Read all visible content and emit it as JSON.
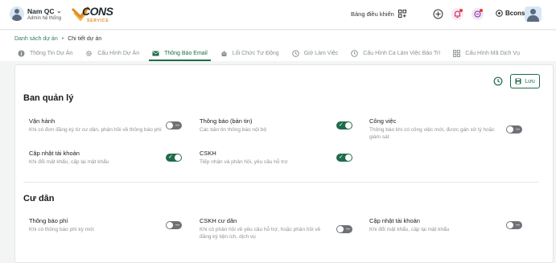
{
  "topbar": {
    "user_name": "Nam QC",
    "user_role": "Admin hệ thống",
    "logo_text": "CONS",
    "logo_sub": "SERVICE",
    "dashboard_label": "Bảng điều khiển",
    "org_name": "Bcons"
  },
  "breadcrumb": {
    "parent": "Danh sách dự án",
    "current": "Chi tiết dự án"
  },
  "tabs": [
    {
      "label": "Thông Tin Dự Án",
      "icon": "info-icon"
    },
    {
      "label": "Cấu Hình Dự Án",
      "icon": "gear-icon"
    },
    {
      "label": "Thông Báo Email",
      "icon": "mail-icon",
      "active": true
    },
    {
      "label": "Lối Chức Tự Động",
      "icon": "robot-icon"
    },
    {
      "label": "Giờ Làm Việc",
      "icon": "clock-icon"
    },
    {
      "label": "Cấu Hình Ca Làm Việc Bảo Trì",
      "icon": "clock-icon"
    },
    {
      "label": "Cấu Hình Mã Dịch Vụ",
      "icon": "grid-icon"
    }
  ],
  "actions": {
    "save_label": "Lưu"
  },
  "sections": {
    "management": {
      "title": "Ban quản lý",
      "items": [
        {
          "title": "Vận hành",
          "desc": "Khi có đơn đăng ký từ cư dân, phản hồi về thông báo phí",
          "enabled": false
        },
        {
          "title": "Thông báo (bản tin)",
          "desc": "Các bản tin thông báo nội bộ",
          "enabled": true
        },
        {
          "title": "Công việc",
          "desc": "Thông báo khi có công việc mới, được gán xử lý hoặc giám sát",
          "enabled": false
        },
        {
          "title": "Cập nhật tài khoản",
          "desc": "Khi đổi mật khẩu, cấp lại mật khẩu",
          "enabled": true
        },
        {
          "title": "CSKH",
          "desc": "Tiếp nhận và phản hồi, yêu cầu hỗ trợ",
          "enabled": true
        }
      ]
    },
    "residents": {
      "title": "Cư dân",
      "items": [
        {
          "title": "Thông báo phí",
          "desc": "Khi có thông báo phí kỳ mới",
          "enabled": false
        },
        {
          "title": "CSKH cư dân",
          "desc": "Khi có phản hồi về yêu cầu hỗ trợ, hoặc phản hồi về đăng ký tiện ích, dịch vụ",
          "enabled": false
        },
        {
          "title": "Cập nhật tài khoản",
          "desc": "Khi đổi mật khẩu, cấp lại mật khẩu",
          "enabled": false
        }
      ]
    }
  },
  "colors": {
    "accent": "#1f6b4a",
    "toggle_off": "#6e7276",
    "notification_dot": "#e53935"
  }
}
